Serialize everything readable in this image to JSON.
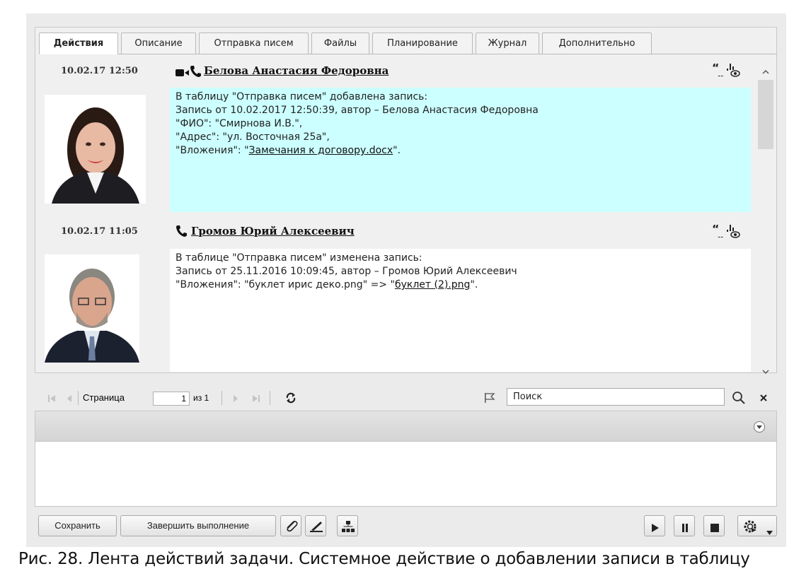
{
  "tabs": [
    {
      "label": "Действия",
      "active": true
    },
    {
      "label": "Описание",
      "active": false
    },
    {
      "label": "Отправка писем",
      "active": false
    },
    {
      "label": "Файлы",
      "active": false
    },
    {
      "label": "Планирование",
      "active": false
    },
    {
      "label": "Журнал",
      "active": false
    },
    {
      "label": "Дополнительно",
      "active": false
    }
  ],
  "feed": [
    {
      "datetime": "10.02.17 12:50",
      "author": "Белова Анастасия Федоровна",
      "icons": [
        "video-camera-icon",
        "phone-icon"
      ],
      "lines": [
        "В таблицу \"Отправка писем\" добавлена запись:",
        "",
        "Запись от 10.02.2017 12:50:39, автор – Белова Анастасия Федоровна",
        "\"ФИО\": \"Смирнова И.В.\",",
        "\"Адрес\": \"ул. Восточная 25а\","
      ],
      "attach_prefix": "\"Вложения\": \"",
      "attach_link": "Замечания к договору.docx",
      "attach_suffix": "\".",
      "highlight_color": "#ccffff"
    },
    {
      "datetime": "10.02.17 11:05",
      "author": "Громов Юрий Алексеевич",
      "icons": [
        "phone-icon"
      ],
      "lines": [
        "В таблице \"Отправка писем\" изменена запись:",
        "",
        "Запись от 25.11.2016 10:09:45, автор – Громов Юрий Алексеевич"
      ],
      "attach_prefix": "\"Вложения\": \"буклет ирис деко.png\" => \"",
      "attach_link": "буклет (2).png",
      "attach_suffix": "\"."
    }
  ],
  "pager": {
    "page_label": "Страница",
    "page_value": "1",
    "of_label": "из 1",
    "search_value": "Поиск"
  },
  "buttons": {
    "save": "Сохранить",
    "complete": "Завершить выполнение"
  },
  "caption": "Рис. 28. Лента действий задачи. Системное действие о добавлении записи в таблицу",
  "colors": {
    "highlight": "#ccffff",
    "tab_border": "#b9b9b9",
    "panel_bg": "#f0f0f0"
  }
}
